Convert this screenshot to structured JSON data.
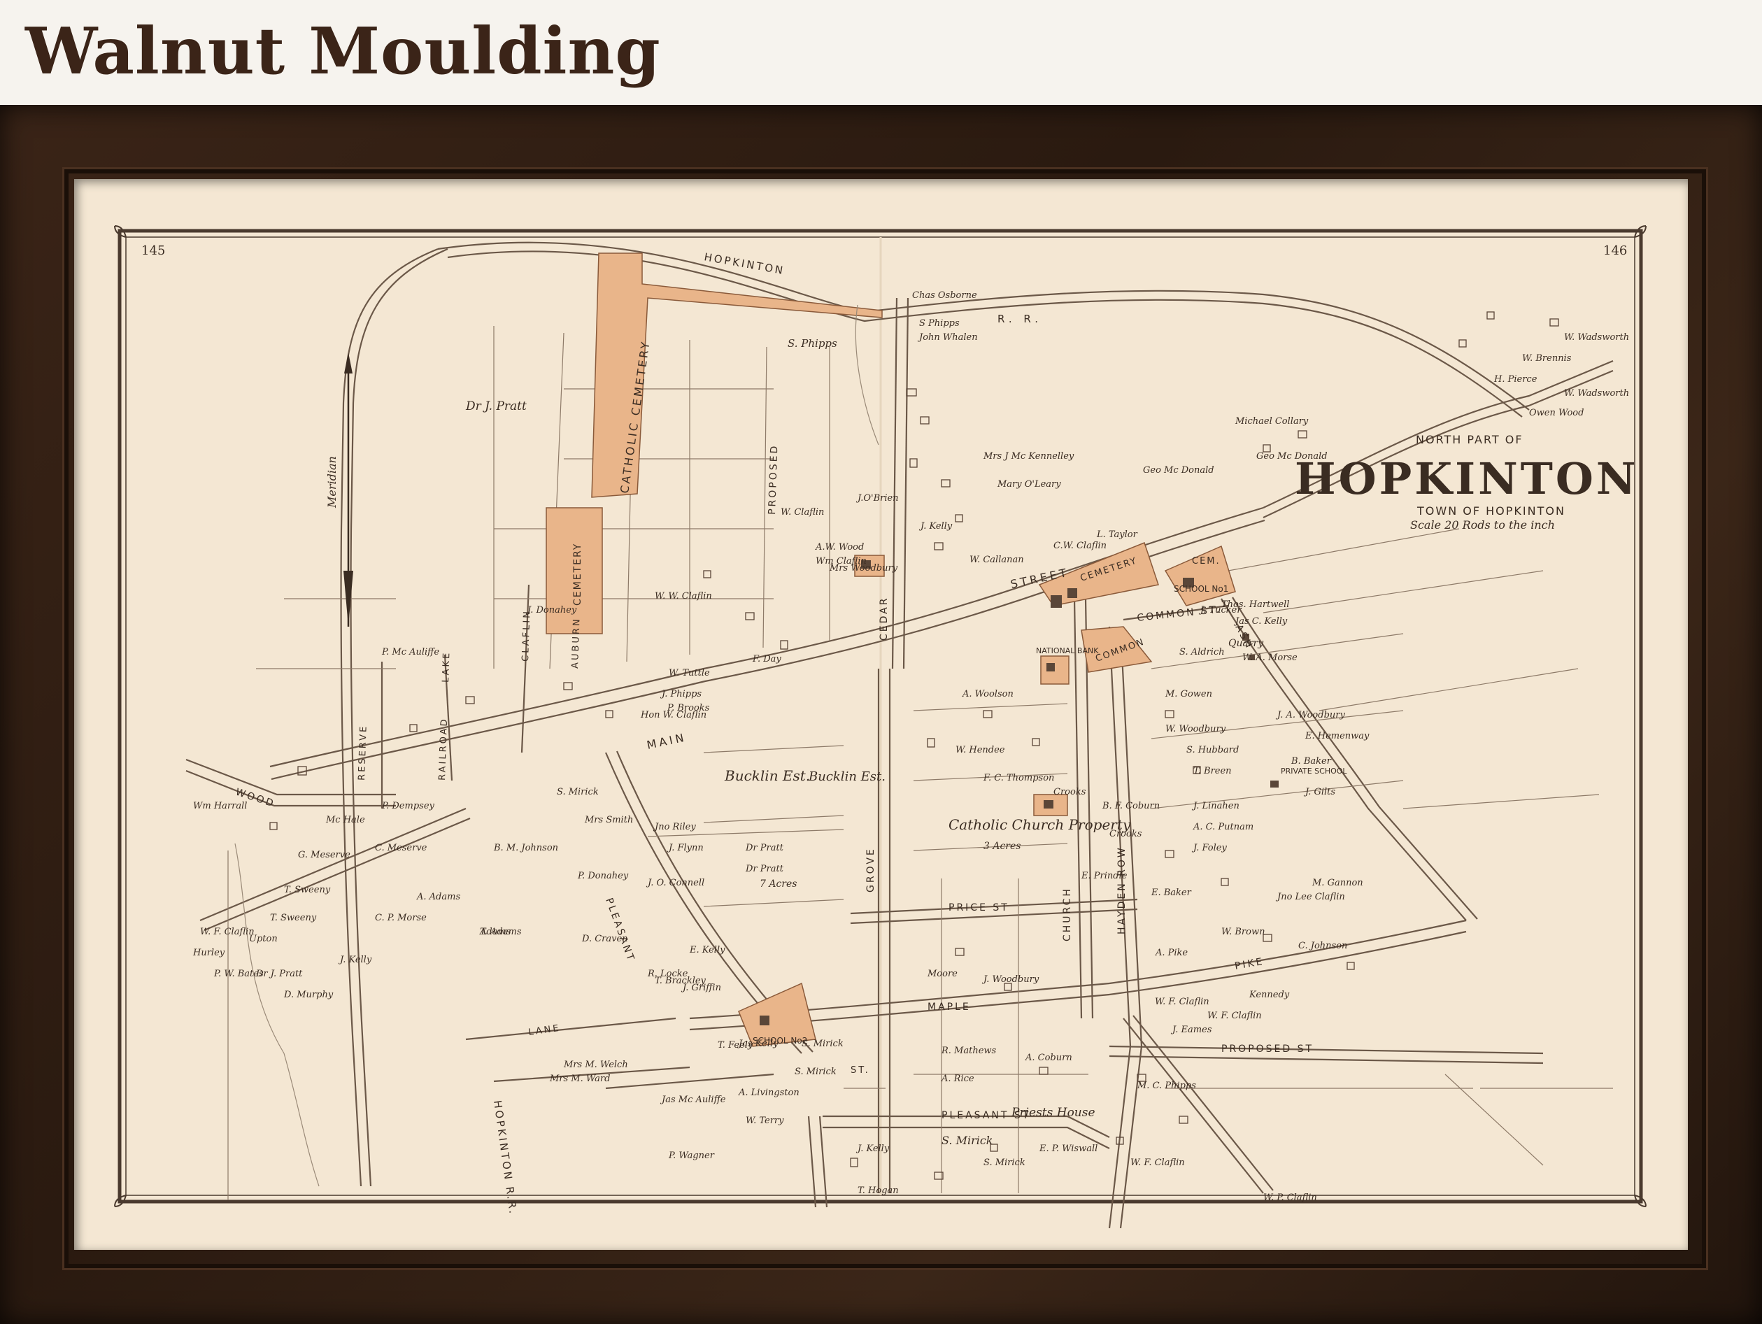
{
  "header": {
    "title": "Walnut Moulding"
  },
  "colors": {
    "frame": "#2d1c12",
    "paper": "#f4e7d3",
    "ink": "#3a2c22",
    "parcel_highlight": "#e9b58a",
    "header_text": "#3b2418"
  },
  "map": {
    "page_left": "145",
    "page_right": "146",
    "title_top": "NORTH PART OF",
    "title_main": "HOPKINTON",
    "title_sub": "TOWN OF HOPKINTON",
    "scale": "Scale 20 Rods to the inch",
    "meridian": "Meridian",
    "streets": {
      "main": "MAIN",
      "street": "STREET",
      "hopkinton_rr_top": "HOPKINTON",
      "rr_top": "R. R.",
      "hopkinton_rr_bottom": "HOPKINTON R.R.",
      "wood": "WOOD",
      "pleasant": "PLEASANT",
      "pleasant_st": "PLEASANT ST",
      "maple": "MAPLE",
      "price": "PRICE ST",
      "grove": "GROVE",
      "cedar": "CEDAR",
      "church": "CHURCH",
      "hayden_row": "HAYDEN ROW",
      "common_st": "COMMON ST.",
      "ash": "ASH",
      "pike": "PIKE",
      "proposed": "PROPOSED",
      "proposed_st": "PROPOSED ST",
      "lane": "LANE",
      "claflin": "CLAFLIN",
      "lake": "LAKE",
      "auburn": "AUBURN",
      "reserve": "RESERVE",
      "railroad": "RAILROAD",
      "st": "ST."
    },
    "places": {
      "catholic_cemetery": "CATHOLIC CEMETERY",
      "cemetery": "CEMETERY",
      "cemetery2": "CEMETERY",
      "cem": "CEM.",
      "school1": "SCHOOL No1",
      "school2": "SCHOOL No2",
      "common": "COMMON",
      "national_bank": "NATIONAL BANK",
      "private_school": "PRIVATE SCHOOL",
      "quarry": "Quarry",
      "catholic_church_property": "Catholic Church Property",
      "three_acres": "3 Acres",
      "bucklin_est": "Bucklin Est.",
      "bucklin_est2": "Bucklin Est.",
      "pratt_7acres": "7 Acres",
      "priests_house": "Priests House"
    },
    "owners": [
      "Dr J. Pratt",
      "S. Phipps",
      "Chas Osborne",
      "S Phipps",
      "John Whalen",
      "W. Wadsworth",
      "W. Brennis",
      "H. Pierce",
      "W. Wadsworth",
      "Owen Wood",
      "Michael Collary",
      "Geo Mc Donald",
      "Geo Mc Donald",
      "Mrs J Mc Kennelley",
      "Mary O'Leary",
      "J.O'Brien",
      "W. W. Claflin",
      "W. Claflin",
      "C.W. Claflin",
      "L. Taylor",
      "W. Callanan",
      "J. Tucker",
      "Jas C. Kelly",
      "W. A. Morse",
      "J. A. Woodbury",
      "E. Hemenway",
      "B. Baker",
      "J. Gilts",
      "J. Linahen",
      "T. Breen",
      "M. Gannon",
      "W. F. Claflin",
      "W. F. Claflin",
      "A. Pike",
      "C. Johnson",
      "Kennedy",
      "W. Brown",
      "A. Coburn",
      "M. C. Phipps",
      "E. P. Wiswall",
      "W. P. Claflin",
      "W. F. Claflin",
      "S. Mirick",
      "S. Mirick",
      "S. Mirick",
      "A. Rice",
      "R. Mathews",
      "Mrs M. Welch",
      "Mrs M. Ward",
      "Jas Mc Auliffe",
      "P. Wagner",
      "W. Terry",
      "A. Livingston",
      "J. Kelly",
      "T. Hogan",
      "Wm Harrall",
      "P. Dempsey",
      "Mc Hale",
      "C. Meserve",
      "G. Meserve",
      "T. Sweeny",
      "T. Sweeny",
      "C. P. Morse",
      "J. Kelly",
      "Dr J. Pratt",
      "A. Adams",
      "Adams",
      "B. M. Johnson",
      "P. Donahey",
      "Jno Riley",
      "J. O. Connell",
      "T. Brackley",
      "J. Flynn",
      "Dr Pratt",
      "Dr Pratt",
      "Hon W. Claflin",
      "J. Donahey",
      "P. Mc Auliffe",
      "A.W. Wood",
      "Wm Claflin",
      "J. Kelly",
      "Moore",
      "T. Feely",
      "S. Mirick",
      "T. Adams",
      "D. Craven",
      "Mrs Smith",
      "S. Mirick",
      "Jas Kelly",
      "R. Locke",
      "E. Kelly",
      "J. Griffin",
      "W. Tuttle",
      "F. Day",
      "J. Phipps",
      "P. Brooks",
      "E. Prindle",
      "B. F. Coburn",
      "J. Woodbury",
      "A. Woolson",
      "Crooks",
      "Crooks",
      "M. Gowen",
      "E. Baker",
      "Thos. Hartwell",
      "S. Aldrich",
      "Jno Lee Claflin",
      "J. Foley",
      "S. Hubbard",
      "A. C. Putnam",
      "W. Woodbury",
      "Mrs Woodbury",
      "W. Hendee",
      "F. C. Thompson",
      "J. Eames",
      "W. F. Claflin",
      "Hurley",
      "P. W. Bates",
      "Upton",
      "D. Murphy",
      "Dr J. Pratt"
    ]
  }
}
